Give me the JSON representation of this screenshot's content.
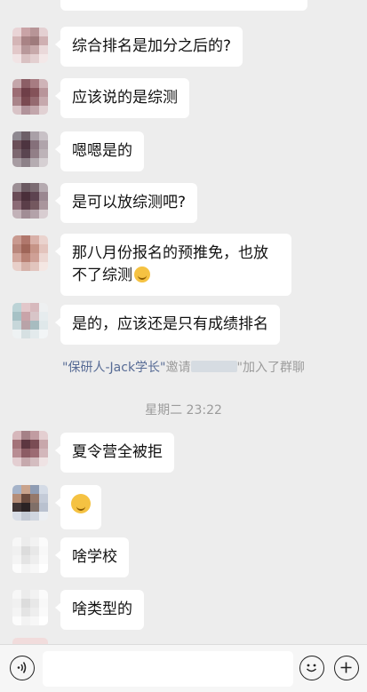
{
  "messages": [
    {
      "text": "综合排名是加分之后的?"
    },
    {
      "text": "应该说的是综测"
    },
    {
      "text": "嗯嗯是的"
    },
    {
      "text": "是可以放综测吧?"
    },
    {
      "text": "那八月份报名的预推免，也放不了综测",
      "emoji": "sweat-smile-emoji"
    },
    {
      "text": "是的，应该还是只有成绩排名"
    },
    {
      "text": "夏令营全被拒"
    },
    {
      "emoji": "smirk-emoji"
    },
    {
      "text": "啥学校"
    },
    {
      "text": "啥类型的"
    }
  ],
  "system": {
    "inviter": "\"保研人-Jack学长\"",
    "invite_verb": "邀请",
    "joined_text": "\"加入了群聊",
    "timestamp": "星期二 23:22"
  },
  "input_bar": {
    "voice_icon": "voice-icon",
    "emoji_icon": "emoji-icon",
    "plus_icon": "plus-icon"
  }
}
